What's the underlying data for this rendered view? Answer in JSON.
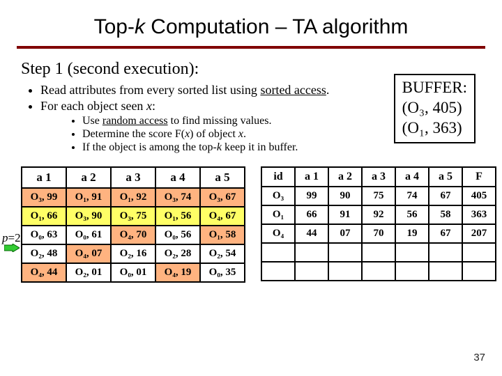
{
  "title_a": "Top-",
  "title_k": "k",
  "title_b": " Computation – TA algorithm",
  "step_a": "Step 1 ",
  "step_b": "(second execution):",
  "bul1_a": "Read attributes from every sorted list using ",
  "bul1_b": "sorted access",
  "bul1_c": ".",
  "bul2_a": "For each object seen ",
  "bul2_x": "x",
  "bul2_b": ":",
  "sub1_a": "Use ",
  "sub1_b": "random access",
  "sub1_c": " to find missing values.",
  "sub2_a": "Determine the score F(",
  "sub2_x": "x",
  "sub2_b": ") of object ",
  "sub2_c": ".",
  "sub3_a": "If the object is among the top-",
  "sub3_k": "k",
  "sub3_b": " keep it in buffer.",
  "buffer_title": "BUFFER:",
  "buffer_l1": "(O₃, 405)",
  "buffer_l2": "(O₁, 363)",
  "left_headers": [
    "a 1",
    "a 2",
    "a 3",
    "a 4",
    "a 5"
  ],
  "L": [
    [
      {
        "t": "O₃, 99",
        "s": 1
      },
      {
        "t": "O₁, 91",
        "s": 1
      },
      {
        "t": "O₁, 92",
        "s": 1
      },
      {
        "t": "O₃, 74",
        "s": 1
      },
      {
        "t": "O₃, 67",
        "s": 1
      }
    ],
    [
      {
        "t": "O₁, 66",
        "s": 2
      },
      {
        "t": "O₃, 90",
        "s": 2
      },
      {
        "t": "O₃, 75",
        "s": 2
      },
      {
        "t": "O₁, 56",
        "s": 2
      },
      {
        "t": "O₄, 67",
        "s": 2
      }
    ],
    [
      {
        "t": "O₀, 63",
        "s": 0
      },
      {
        "t": "O₀, 61",
        "s": 0
      },
      {
        "t": "O₄, 70",
        "s": 1
      },
      {
        "t": "O₀, 56",
        "s": 0
      },
      {
        "t": "O₁, 58",
        "s": 1
      }
    ],
    [
      {
        "t": "O₂, 48",
        "s": 0
      },
      {
        "t": "O₄, 07",
        "s": 1
      },
      {
        "t": "O₂, 16",
        "s": 0
      },
      {
        "t": "O₂, 28",
        "s": 0
      },
      {
        "t": "O₂, 54",
        "s": 0
      }
    ],
    [
      {
        "t": "O₄, 44",
        "s": 1
      },
      {
        "t": "O₂, 01",
        "s": 0
      },
      {
        "t": "O₀, 01",
        "s": 0
      },
      {
        "t": "O₄, 19",
        "s": 1
      },
      {
        "t": "O₀, 35",
        "s": 0
      }
    ]
  ],
  "right_headers": [
    "id",
    "a 1",
    "a 2",
    "a 3",
    "a 4",
    "a 5",
    "F"
  ],
  "R": [
    [
      "O₃",
      "99",
      "90",
      "75",
      "74",
      "67",
      "405"
    ],
    [
      "O₁",
      "66",
      "91",
      "92",
      "56",
      "58",
      "363"
    ],
    [
      "O₄",
      "44",
      "07",
      "70",
      "19",
      "67",
      "207"
    ],
    [
      "",
      "",
      "",
      "",
      "",
      "",
      ""
    ],
    [
      "",
      "",
      "",
      "",
      "",
      "",
      ""
    ]
  ],
  "p_label": "p",
  "p_eq": "=2",
  "page": "37"
}
